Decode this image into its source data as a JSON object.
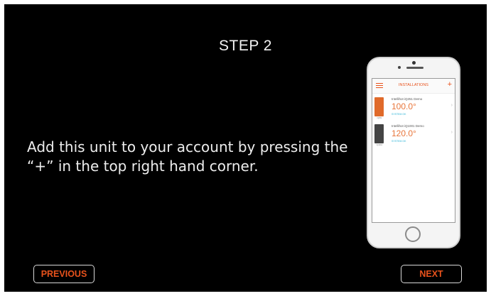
{
  "step_title": "STEP 2",
  "instruction": {
    "line1": "Add this unit to your account by pressing the",
    "line2": "“+” in the top right hand corner."
  },
  "buttons": {
    "previous_label": "PREVIOUS",
    "next_label": "NEXT"
  },
  "colors": {
    "accent": "#e8521c",
    "background": "#000000",
    "text": "#ededed",
    "status": "#2bb3d6"
  },
  "phone_app": {
    "title": "INSTALLATIONS",
    "add_symbol": "+",
    "installations": [
      {
        "name": "Intellihot iQ251 Demo",
        "temperature": "100.0°",
        "status": "SYSTEM OK",
        "thumb_caption": "iQ251"
      },
      {
        "name": "Intellihot iQ1001 Demo",
        "temperature": "120.0°",
        "status": "SYSTEM OK",
        "thumb_caption": "iQ1001"
      }
    ],
    "icons": {
      "menu": "hamburger-menu-icon",
      "add": "plus-icon",
      "chevron": "chevron-right-icon"
    }
  }
}
